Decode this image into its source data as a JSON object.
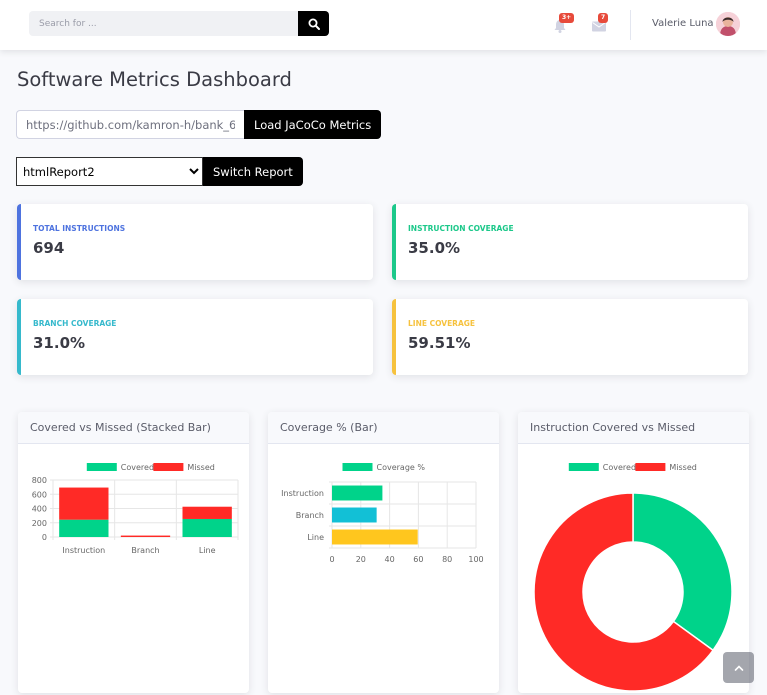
{
  "search": {
    "placeholder": "Search for ..."
  },
  "alerts": {
    "badge": "3+"
  },
  "messages": {
    "badge": "7"
  },
  "user": {
    "name": "Valerie Luna"
  },
  "page_title": "Software Metrics Dashboard",
  "load": {
    "url_value": "https://github.com/kamron-h/bank_6_te",
    "button_label": "Load JaCoCo Metrics"
  },
  "report": {
    "selected": "htmlReport2",
    "button_label": "Switch Report"
  },
  "stats": [
    {
      "label": "Total Instructions",
      "value": "694",
      "color": "#4e73df"
    },
    {
      "label": "Instruction Coverage",
      "value": "35.0%",
      "color": "#1cc88a"
    },
    {
      "label": "Branch Coverage",
      "value": "31.0%",
      "color": "#36b9cc"
    },
    {
      "label": "Line Coverage",
      "value": "59.51%",
      "color": "#f6c23e"
    }
  ],
  "charts": [
    {
      "title": "Covered vs Missed (Stacked Bar)"
    },
    {
      "title": "Coverage % (Bar)"
    },
    {
      "title": "Instruction Covered vs Missed"
    }
  ],
  "chart_data": [
    {
      "type": "bar",
      "stacked": true,
      "categories": [
        "Instruction",
        "Branch",
        "Line"
      ],
      "series": [
        {
          "name": "Covered",
          "values": [
            243,
            0,
            253
          ],
          "color": "#00d38a"
        },
        {
          "name": "Missed",
          "values": [
            451,
            20,
            172
          ],
          "color": "#ff2a26"
        }
      ],
      "ylim": [
        0,
        800
      ],
      "yticks": [
        0,
        200,
        400,
        600,
        800
      ],
      "grid": true,
      "legend": "top"
    },
    {
      "type": "bar",
      "orientation": "horizontal",
      "categories": [
        "Instruction",
        "Branch",
        "Line"
      ],
      "series": [
        {
          "name": "Coverage %",
          "values": [
            35.0,
            31.0,
            59.51
          ],
          "colors": [
            "#00d38a",
            "#12c0d6",
            "#ffc61e"
          ]
        }
      ],
      "xlim": [
        0,
        100
      ],
      "xticks": [
        0,
        20,
        40,
        60,
        80,
        100
      ],
      "grid": true,
      "legend": "top"
    },
    {
      "type": "pie",
      "donut": true,
      "labels": [
        "Covered",
        "Missed"
      ],
      "values": [
        243,
        451
      ],
      "colors": [
        "#00d38a",
        "#ff2a26"
      ],
      "legend": "top"
    }
  ]
}
